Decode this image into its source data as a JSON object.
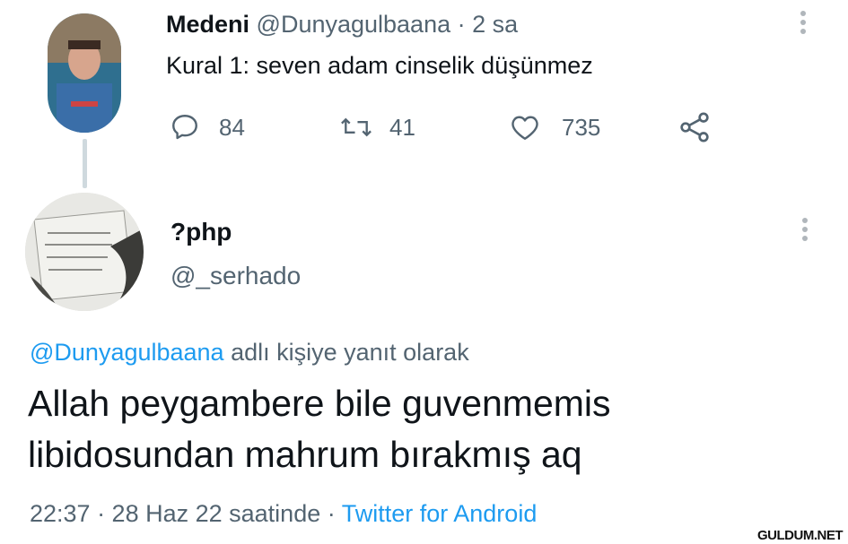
{
  "tweet1": {
    "display_name": "Medeni",
    "handle": "@Dunyagulbaana",
    "time": "· 2 sa",
    "text": "Kural 1: seven adam cinselik düşünmez",
    "actions": {
      "reply_count": "84",
      "retweet_count": "41",
      "like_count": "735"
    }
  },
  "tweet2": {
    "display_name": "?php",
    "handle": "@_serhado",
    "reply_to_handle": "@Dunyagulbaana",
    "reply_to_suffix": " adlı kişiye yanıt olarak",
    "text_line1": "Allah peygambere bile guvenmemis",
    "text_line2": "libidosundan mahrum bırakmış aq",
    "timestamp": "22:37 · 28 Haz 22 saatinde · ",
    "source": "Twitter for Android"
  },
  "watermark": "GULDUM.NET",
  "colors": {
    "accent": "#1d9bf0",
    "muted": "#536471"
  }
}
